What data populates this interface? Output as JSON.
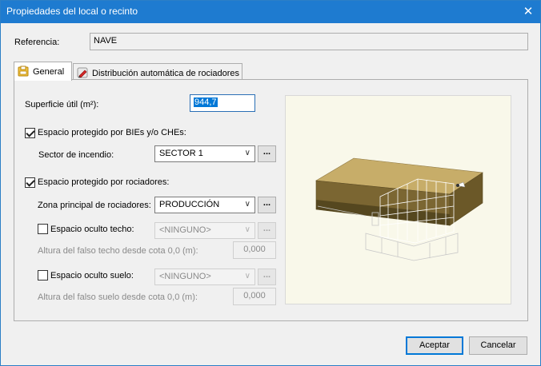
{
  "window": {
    "title": "Propiedades del local o recinto",
    "close_symbol": "✕"
  },
  "referencia": {
    "label": "Referencia:",
    "value": "NAVE"
  },
  "tabs": [
    {
      "label": "General",
      "icon": "general-tab-icon",
      "active": true
    },
    {
      "label": "Distribución automática de rociadores",
      "icon": "sprinkler-pencil-icon",
      "active": false
    }
  ],
  "general": {
    "superficie": {
      "label": "Superficie útil (m²):",
      "value": "944,7"
    },
    "bies": {
      "label": "Espacio protegido por BIEs y/o CHEs:",
      "checked": true
    },
    "sector": {
      "label": "Sector de incendio:",
      "value": "SECTOR 1",
      "more": "..."
    },
    "rociadores": {
      "label": "Espacio protegido por rociadores:",
      "checked": true
    },
    "zona": {
      "label": "Zona principal de rociadores:",
      "value": "PRODUCCIÓN",
      "more": "..."
    },
    "oculto_techo": {
      "label": "Espacio oculto techo:",
      "checked": false,
      "value": "<NINGUNO>",
      "more": "..."
    },
    "altura_techo": {
      "label": "Altura del falso techo desde cota 0,0 (m):",
      "value": "0,000"
    },
    "oculto_suelo": {
      "label": "Espacio oculto suelo:",
      "checked": false,
      "value": "<NINGUNO>",
      "more": "..."
    },
    "altura_suelo": {
      "label": "Altura del falso suelo desde cota 0,0 (m):",
      "value": "0,000"
    }
  },
  "buttons": {
    "accept": "Aceptar",
    "cancel": "Cancelar"
  },
  "colors": {
    "titlebar": "#1e7bd0",
    "preview_bg": "#f9f8ea",
    "building_top": "#c7ad69",
    "building_side": "#7b6632",
    "building_dark": "#55471f"
  }
}
